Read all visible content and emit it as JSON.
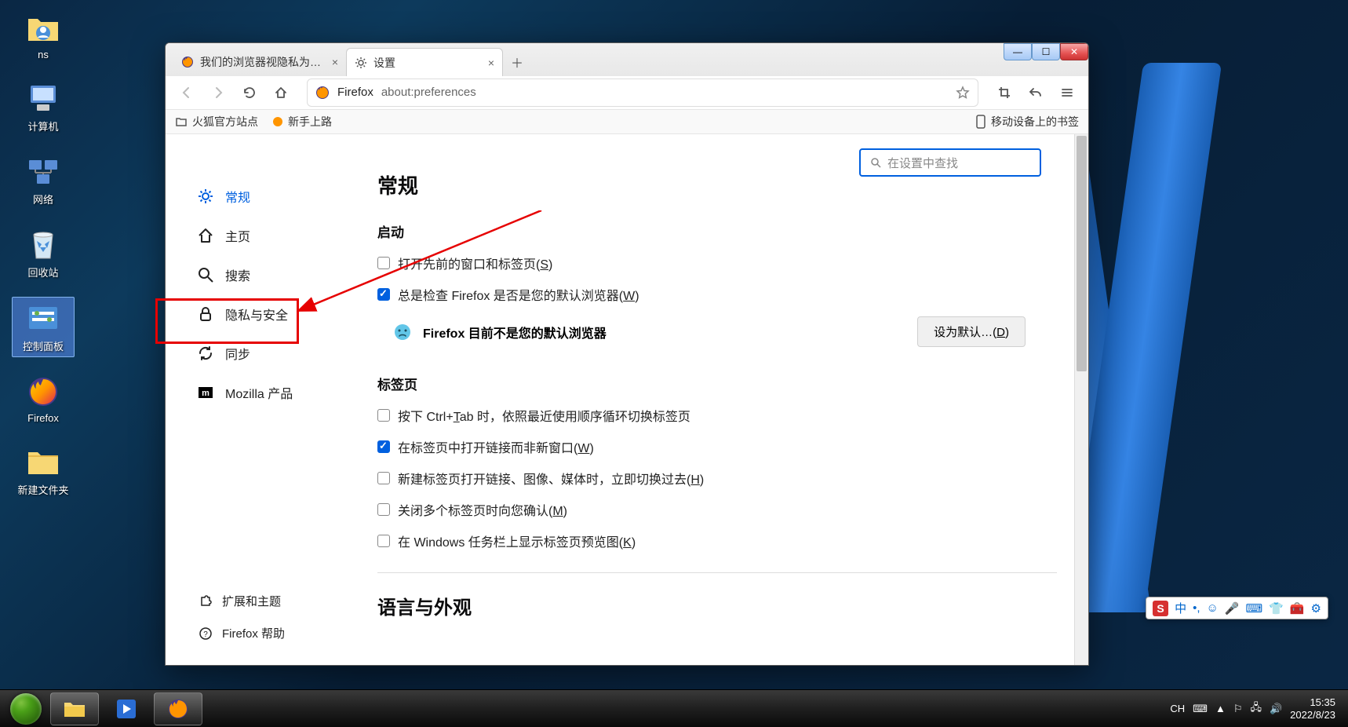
{
  "desktop_icons": [
    {
      "label": "ns",
      "icon": "folder-user"
    },
    {
      "label": "计算机",
      "icon": "computer"
    },
    {
      "label": "网络",
      "icon": "network"
    },
    {
      "label": "回收站",
      "icon": "recycle-bin"
    },
    {
      "label": "控制面板",
      "icon": "control-panel",
      "selected": true
    },
    {
      "label": "Firefox",
      "icon": "firefox"
    },
    {
      "label": "新建文件夹",
      "icon": "folder"
    }
  ],
  "window": {
    "tabs": [
      {
        "title": "我们的浏览器视隐私为先—这是",
        "active": false,
        "icon": "firefox"
      },
      {
        "title": "设置",
        "active": true,
        "icon": "gear"
      }
    ],
    "navbar": {
      "url_protocol_label": "Firefox",
      "url_path": "about:preferences"
    },
    "bookmarks": {
      "items": [
        "火狐官方站点",
        "新手上路"
      ],
      "right": "移动设备上的书签"
    }
  },
  "settings": {
    "search_placeholder": "在设置中查找",
    "categories": [
      {
        "key": "general",
        "label": "常规",
        "active": true,
        "icon": "gear"
      },
      {
        "key": "home",
        "label": "主页",
        "icon": "home"
      },
      {
        "key": "search",
        "label": "搜索",
        "icon": "search"
      },
      {
        "key": "privacy",
        "label": "隐私与安全",
        "icon": "lock"
      },
      {
        "key": "sync",
        "label": "同步",
        "icon": "sync"
      },
      {
        "key": "mozilla",
        "label": "Mozilla 产品",
        "icon": "mozilla"
      }
    ],
    "footer": [
      {
        "label": "扩展和主题",
        "icon": "puzzle"
      },
      {
        "label": "Firefox 帮助",
        "icon": "help"
      }
    ],
    "main": {
      "page_title": "常规",
      "startup": {
        "heading": "启动",
        "restore_prev": {
          "label_main": "打开先前的窗口和标签页(",
          "accel": "S",
          "label_tail": ")",
          "checked": false
        },
        "always_check": {
          "label_main": "总是检查 Firefox 是否是您的默认浏览器(",
          "accel": "W",
          "label_tail": ")",
          "checked": true
        },
        "not_default_msg": "Firefox 目前不是您的默认浏览器",
        "set_default_btn_main": "设为默认…(",
        "set_default_btn_accel": "D",
        "set_default_btn_tail": ")"
      },
      "tabs": {
        "heading": "标签页",
        "ctrl_tab": {
          "label_pre": "按下 Ctrl+",
          "accel": "T",
          "label_post": "ab 时，依照最近使用顺序循环切换标签页",
          "checked": false
        },
        "open_in_tabs": {
          "label_main": "在标签页中打开链接而非新窗口(",
          "accel": "W",
          "label_tail": ")",
          "checked": true
        },
        "switch_immediately": {
          "label_main": "新建标签页打开链接、图像、媒体时，立即切换过去(",
          "accel": "H",
          "label_tail": ")",
          "checked": false
        },
        "confirm_close": {
          "label_main": "关闭多个标签页时向您确认(",
          "accel": "M",
          "label_tail": ")",
          "checked": false
        },
        "taskbar_preview": {
          "label_main": "在 Windows 任务栏上显示标签页预览图(",
          "accel": "K",
          "label_tail": ")",
          "checked": false
        }
      },
      "language_heading": "语言与外观"
    }
  },
  "taskbar": {
    "apps": [
      {
        "name": "explorer",
        "active": true
      },
      {
        "name": "media-player",
        "active": false
      },
      {
        "name": "firefox",
        "active": true
      }
    ],
    "tray": {
      "ch": "CH"
    },
    "clock": {
      "time": "15:35",
      "date": "2022/8/23"
    }
  },
  "ime": {
    "mode": "中"
  }
}
